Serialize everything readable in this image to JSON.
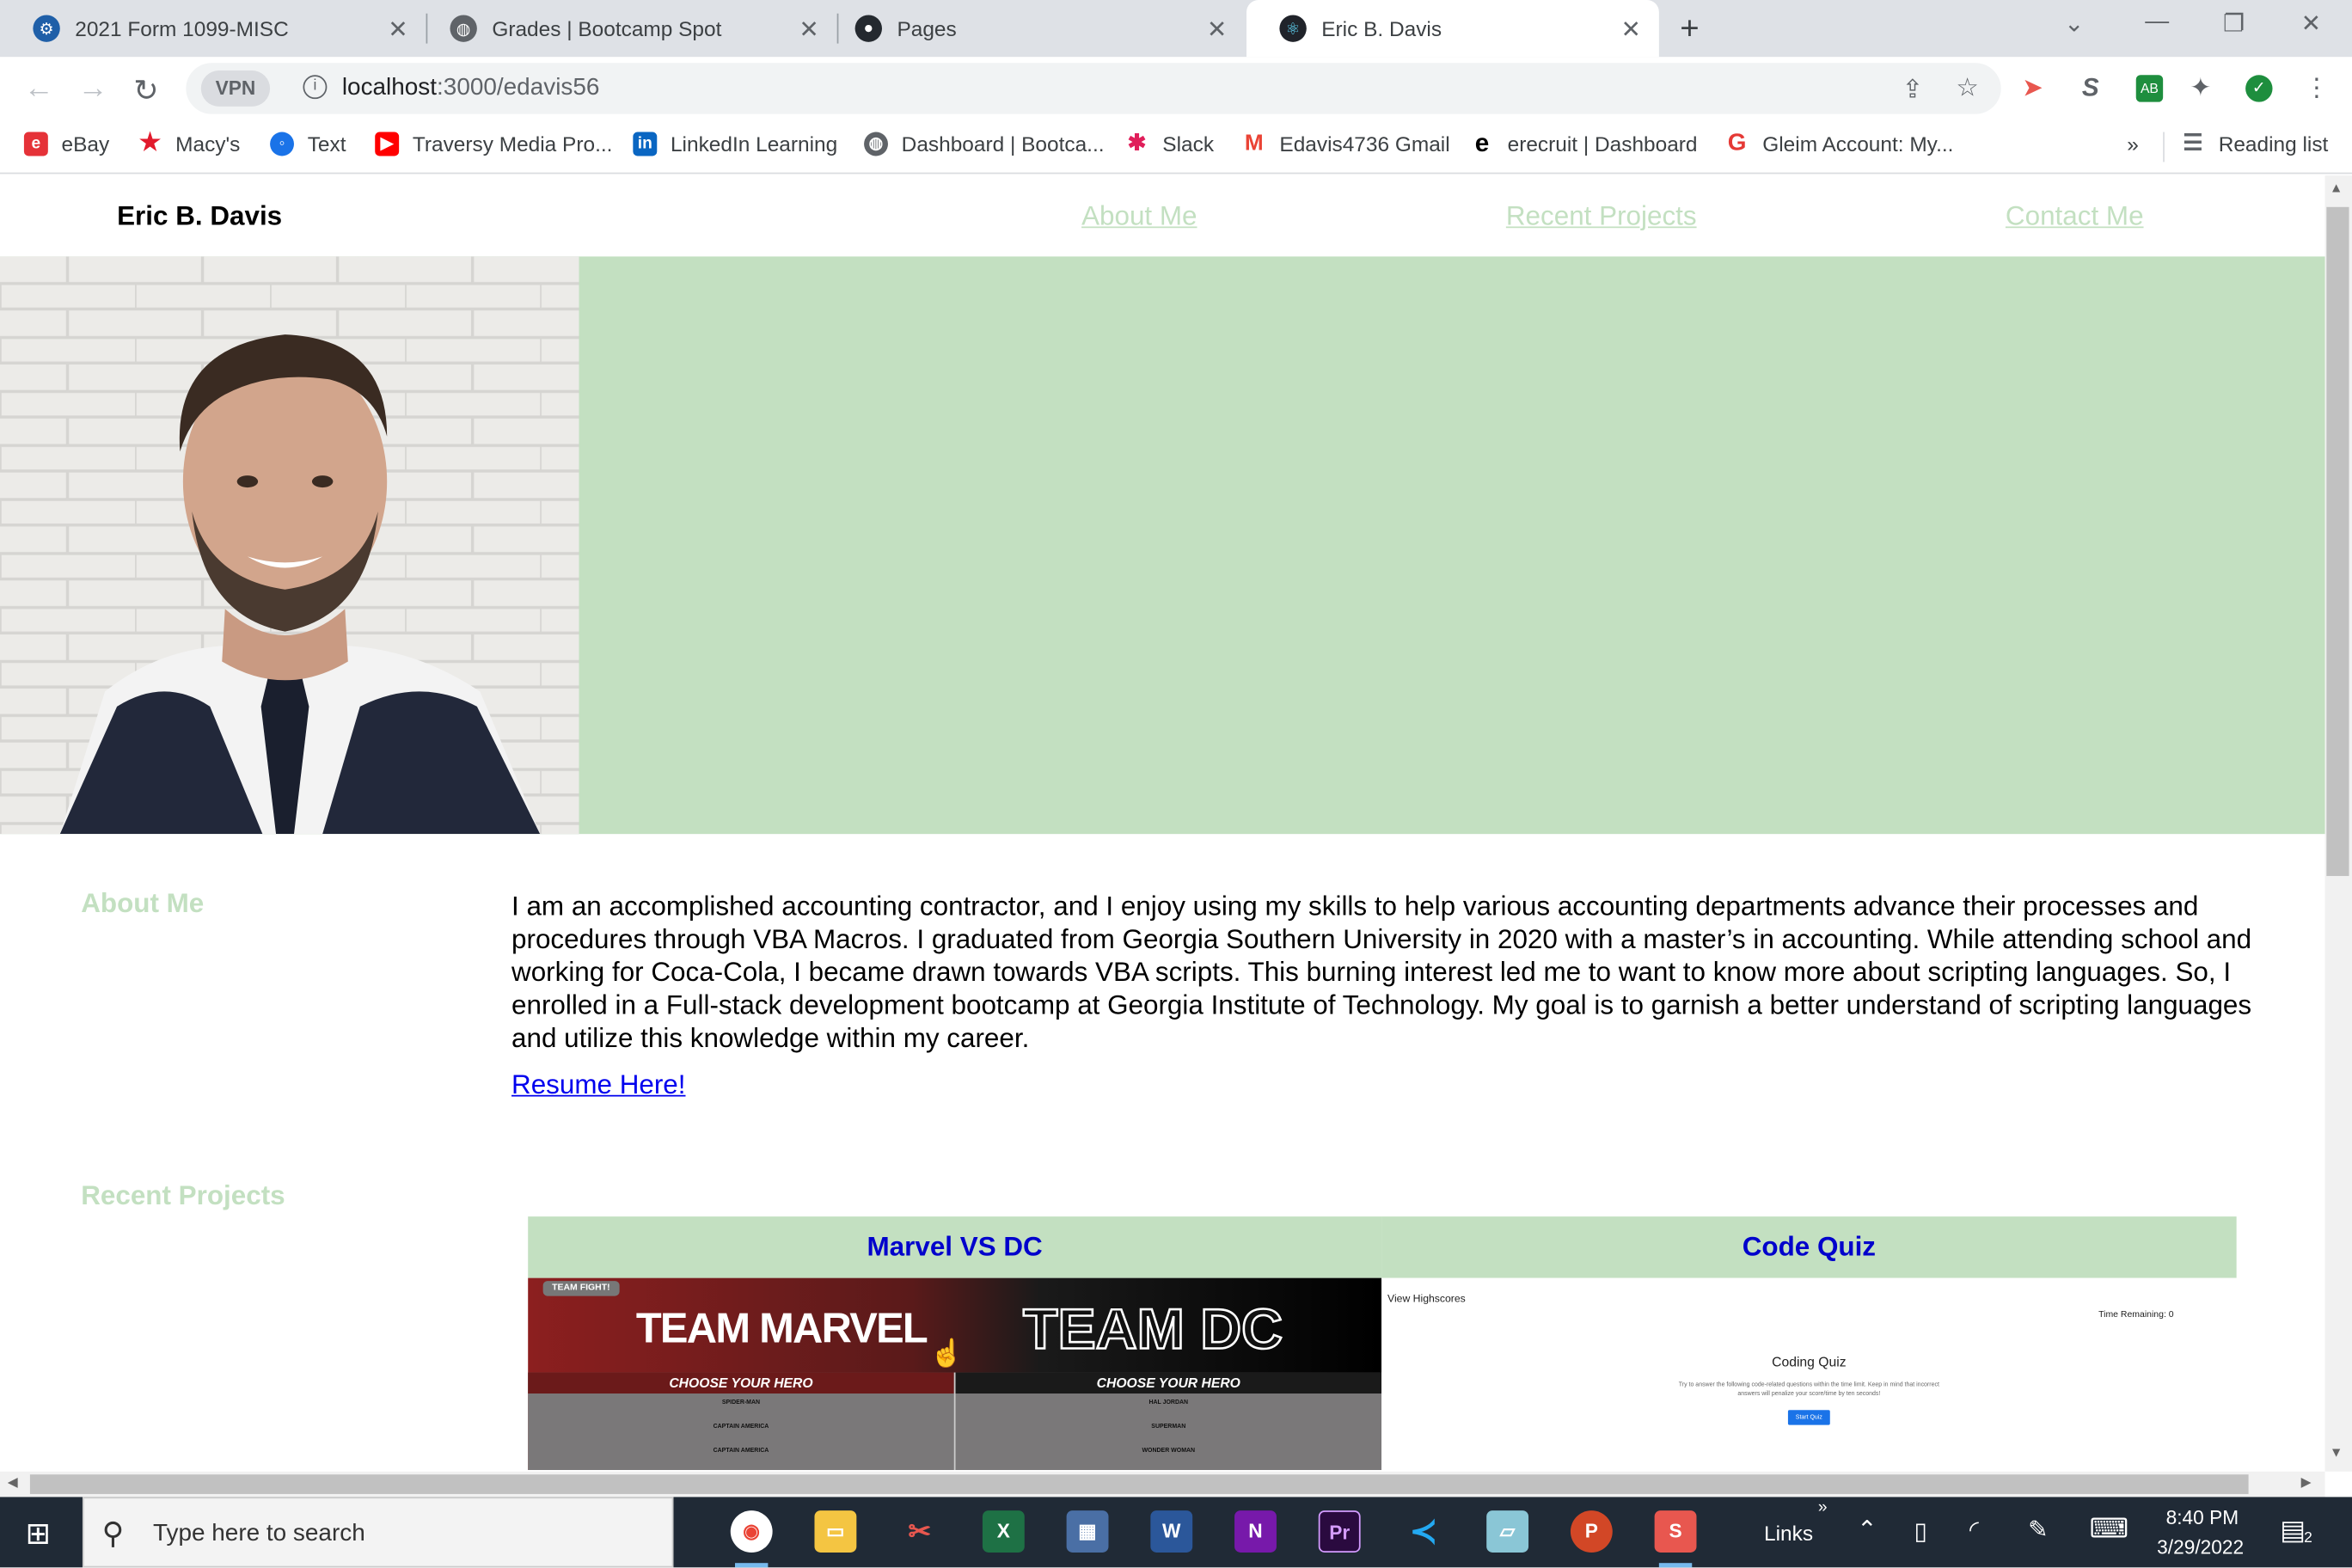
{
  "browser": {
    "tabs": [
      {
        "title": "2021 Form 1099-MISC",
        "icon": "irs-icon"
      },
      {
        "title": "Grades | Bootcamp Spot",
        "icon": "globe-icon"
      },
      {
        "title": "Pages",
        "icon": "github-icon"
      },
      {
        "title": "Eric B. Davis",
        "icon": "react-icon",
        "active": true
      }
    ],
    "vpn_label": "VPN",
    "url_host": "localhost",
    "url_path": ":3000/edavis56",
    "bookmarks": [
      "eBay",
      "Macy's",
      "Text",
      "Traversy Media Pro...",
      "LinkedIn Learning",
      "Dashboard | Bootca...",
      "Slack",
      "Edavis4736 Gmail",
      "erecruit | Dashboard",
      "Gleim Account: My..."
    ],
    "bookmarks_overflow": "»",
    "reading_list": "Reading list"
  },
  "page": {
    "brand": "Eric B. Davis",
    "nav": [
      "About Me",
      "Recent Projects",
      "Contact Me"
    ],
    "about_title": "About Me",
    "about_text": "I am an accomplished accounting contractor, and I enjoy using my skills to help various accounting departments advance their processes and procedures through VBA Macros. I graduated from Georgia Southern University in 2020 with a master’s in accounting. While attending school and working for Coca-Cola, I became drawn towards VBA scripts. This burning interest led me to want to know more about scripting languages. So, I enrolled in a Full-stack development bootcamp at Georgia Institute of Technology. My goal is to garnish a better understand of scripting languages and utilize this knowledge within my career.",
    "resume_link": "Resume Here!",
    "projects_title": "Recent Projects",
    "projects": [
      {
        "title": "Marvel VS DC",
        "thumb": {
          "badge": "TEAM FIGHT!",
          "left_title": "TEAM MARVEL",
          "right_title": "TEAM DC",
          "choose": "CHOOSE YOUR HERO",
          "left_items": [
            "SPIDER-MAN",
            "CAPTAIN AMERICA",
            "CAPTAIN AMERICA"
          ],
          "right_items": [
            "HAL JORDAN",
            "SUPERMAN",
            "WONDER WOMAN"
          ]
        }
      },
      {
        "title": "Code Quiz",
        "thumb": {
          "highscores": "View Highscores",
          "timer": "Time Remaining: 0",
          "heading": "Coding Quiz",
          "desc": "Try to answer the following code-related questions within the time limit. Keep in mind that incorrect answers will penalize your score/time by ten seconds!",
          "button": "Start Quiz"
        }
      }
    ]
  },
  "taskbar": {
    "search_placeholder": "Type here to search",
    "links_label": "Links",
    "time": "8:40 PM",
    "date": "3/29/2022",
    "notification_count": "2"
  },
  "colors": {
    "accent_green": "#c3e0c1",
    "link_blue": "#0000ee"
  }
}
